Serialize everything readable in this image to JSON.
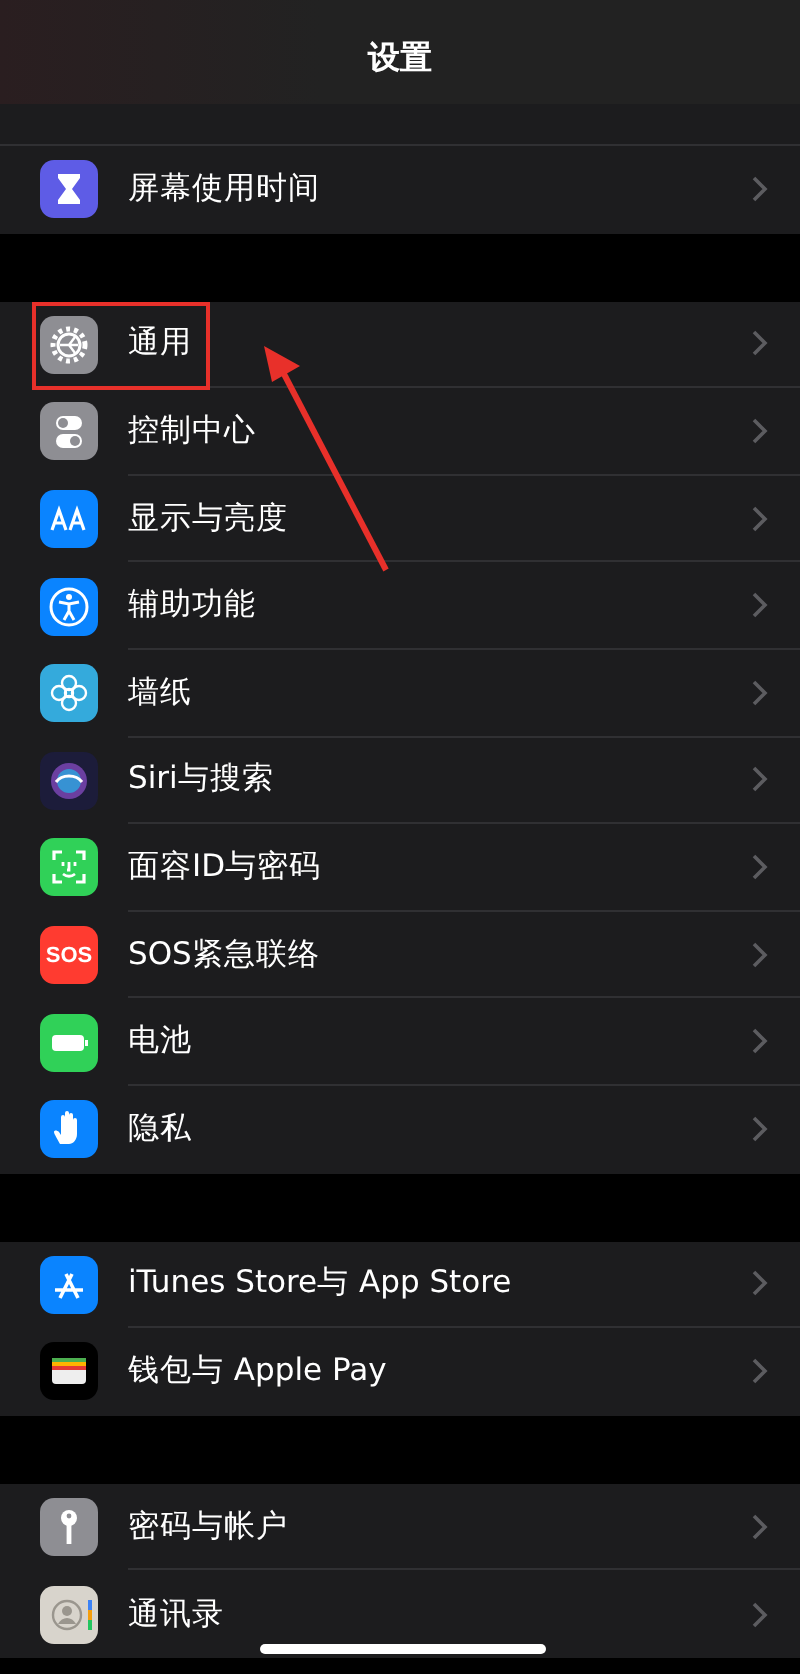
{
  "navigation_bar": {
    "title": "设置"
  },
  "sections": [
    {
      "rows": [
        {
          "label": "屏幕使用时间",
          "highlighted": false
        }
      ]
    },
    {
      "rows": [
        {
          "label": "通用",
          "highlighted": true
        },
        {
          "label": "控制中心",
          "highlighted": false
        },
        {
          "label": "显示与亮度",
          "highlighted": false
        },
        {
          "label": "辅助功能",
          "highlighted": false
        },
        {
          "label": "墙纸",
          "highlighted": false
        },
        {
          "label": "Siri与搜索",
          "highlighted": false
        },
        {
          "label": "面容ID与密码",
          "highlighted": false
        },
        {
          "label": "SOS紧急联络",
          "icon_text": "SOS",
          "highlighted": false
        },
        {
          "label": "电池",
          "highlighted": false
        },
        {
          "label": "隐私",
          "highlighted": false
        }
      ]
    },
    {
      "rows": [
        {
          "label": "iTunes Store与 App Store",
          "highlighted": false
        },
        {
          "label": "钱包与 Apple Pay",
          "highlighted": false
        }
      ]
    },
    {
      "rows": [
        {
          "label": "密码与帐户",
          "highlighted": false
        },
        {
          "label": "通讯录",
          "highlighted": false
        }
      ]
    }
  ]
}
